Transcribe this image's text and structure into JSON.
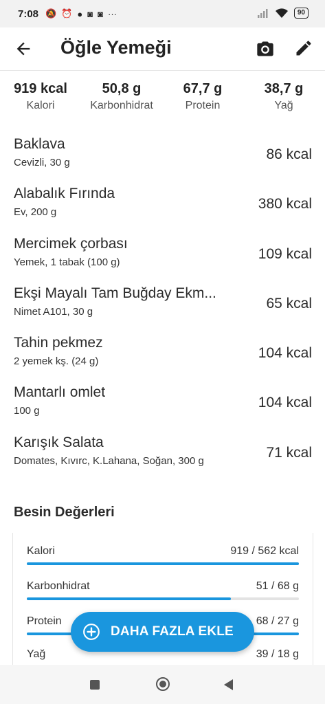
{
  "status_bar": {
    "time": "7:08",
    "left_icons": [
      "mute-icon",
      "alarm-icon",
      "app-icon",
      "instagram-icon",
      "instagram-icon",
      "more-icon"
    ],
    "more": "···",
    "battery": "90"
  },
  "app_bar": {
    "title": "Öğle Yemeği"
  },
  "summary": [
    {
      "value": "919 kcal",
      "label": "Kalori"
    },
    {
      "value": "50,8 g",
      "label": "Karbonhidrat"
    },
    {
      "value": "67,7 g",
      "label": "Protein"
    },
    {
      "value": "38,7 g",
      "label": "Yağ"
    }
  ],
  "foods": [
    {
      "name": "Baklava",
      "detail": "Cevizli, 30 g",
      "kcal": "86 kcal"
    },
    {
      "name": "Alabalık Fırında",
      "detail": "Ev, 200 g",
      "kcal": "380 kcal"
    },
    {
      "name": "Mercimek çorbası",
      "detail": "Yemek, 1 tabak (100 g)",
      "kcal": "109 kcal"
    },
    {
      "name": "Ekşi Mayalı Tam Buğday Ekm...",
      "detail": "Nimet A101, 30 g",
      "kcal": "65 kcal"
    },
    {
      "name": "Tahin pekmez",
      "detail": "2 yemek kş. (24 g)",
      "kcal": "104 kcal"
    },
    {
      "name": "Mantarlı omlet",
      "detail": "100 g",
      "kcal": "104 kcal"
    },
    {
      "name": "Karışık Salata",
      "detail": "Domates, Kıvırc, K.Lahana, Soğan, 300 g",
      "kcal": "71 kcal"
    }
  ],
  "nutrition": {
    "title": "Besin Değerleri",
    "rows": [
      {
        "label": "Kalori",
        "value": "919 / 562 kcal",
        "progress": 1.0
      },
      {
        "label": "Karbonhidrat",
        "value": "51 / 68 g",
        "progress": 0.75
      },
      {
        "label": "Protein",
        "value": "68 / 27 g",
        "progress": 1.0
      },
      {
        "label": "Yağ",
        "value": "39 / 18 g",
        "progress": 1.0
      }
    ]
  },
  "fab": {
    "label": "DAHA FAZLA EKLE"
  },
  "colors": {
    "accent": "#1a96de"
  }
}
